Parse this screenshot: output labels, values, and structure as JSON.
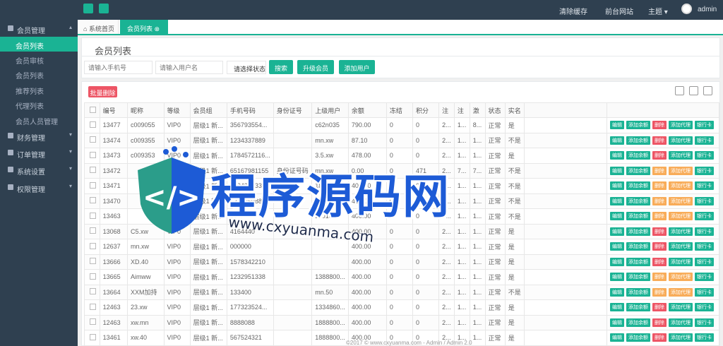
{
  "topbar": {
    "links": [
      "清除缓存",
      "前台网站",
      "主题"
    ],
    "theme_caret": "▾",
    "username": "admin"
  },
  "sidebar": {
    "groups": [
      {
        "label": "会员管理",
        "arrow": "▴"
      },
      {
        "label": "财务管理",
        "arrow": "▾"
      },
      {
        "label": "订单管理",
        "arrow": "▾"
      },
      {
        "label": "系统设置",
        "arrow": "▾"
      },
      {
        "label": "权限管理",
        "arrow": "▾"
      }
    ],
    "items": [
      "会员列表",
      "会员审核",
      "会员列表",
      "推荐列表",
      "代理列表",
      "会员人员管理"
    ]
  },
  "tabs": {
    "home": "系统首页",
    "active": "会员列表",
    "close": "⊗"
  },
  "toolbar": {
    "title": "会员列表",
    "phone_placeholder": "请输入手机号",
    "account_placeholder": "请输入用户名",
    "status_select": "请选择状态",
    "search_label": "搜索",
    "upgrade_label": "升级会员",
    "add_user_label": "添加用户"
  },
  "table_toolbar": {
    "batch_delete_label": "批量删除"
  },
  "table": {
    "headers": [
      "编号",
      "昵称",
      "等级",
      "会员组",
      "手机号码",
      "身份证号",
      "上级用户",
      "余额",
      "冻结",
      "积分",
      "注",
      "注",
      "激",
      "状态",
      "实名",
      ""
    ],
    "rows": [
      [
        "13477",
        "c009055",
        "VIP0",
        "层级1 新...",
        "356793554...",
        "",
        "c62n035",
        "790.00",
        "0",
        "0",
        "2...",
        "1...",
        "8...",
        "正常",
        "是"
      ],
      [
        "13474",
        "c009355",
        "VIP0",
        "层级1 新...",
        "1234337889",
        "",
        "mn.xw",
        "87.10",
        "0",
        "0",
        "2...",
        "1...",
        "1...",
        "正常",
        "不是"
      ],
      [
        "13473",
        "c009353",
        "VIP0",
        "层级1 新...",
        "1784572116...",
        "",
        "3.5.xw",
        "478.00",
        "0",
        "0",
        "2...",
        "1...",
        "1...",
        "正常",
        "是"
      ],
      [
        "13472",
        "",
        "VIP0",
        "层级1 新...",
        "65167981155",
        "身份证号码",
        "mn.xw",
        "0.00",
        "0",
        "471",
        "2...",
        "7...",
        "7...",
        "正常",
        "不是"
      ],
      [
        "13471",
        "",
        "VIP0",
        "层级1 新...",
        "1234328335",
        "",
        "18.mn.xw",
        "400.00",
        "0",
        "0",
        "2...",
        "1...",
        "1...",
        "正常",
        "不是"
      ],
      [
        "13470",
        "",
        "VIP0",
        "层级1 新...",
        "133335988",
        "",
        "J0010.8",
        "400.00",
        "0",
        "0",
        "2...",
        "1...",
        "1...",
        "正常",
        "不是"
      ],
      [
        "13463",
        "",
        "VIP0",
        "层级1 新...",
        "13...",
        "",
        "J0010.8",
        "400.00",
        "0",
        "0",
        "2...",
        "1...",
        "1...",
        "正常",
        "不是"
      ],
      [
        "13068",
        "C5.xw",
        "VIP0",
        "层级1 新...",
        "4164440",
        "",
        "",
        "400.00",
        "0",
        "0",
        "2...",
        "1...",
        "1...",
        "正常",
        "是"
      ],
      [
        "12637",
        "mn.xw",
        "VIP0",
        "层级1 新...",
        "000000",
        "",
        "",
        "400.00",
        "0",
        "0",
        "2...",
        "1...",
        "1...",
        "正常",
        "是"
      ],
      [
        "13666",
        "XD.40",
        "VIP0",
        "层级1 新...",
        "1578342210",
        "",
        "",
        "400.00",
        "0",
        "0",
        "2...",
        "1...",
        "1...",
        "正常",
        "是"
      ],
      [
        "13665",
        "Aimww",
        "VIP0",
        "层级1 新...",
        "1232951338",
        "",
        "1388800...",
        "400.00",
        "0",
        "0",
        "2...",
        "1...",
        "1...",
        "正常",
        "是"
      ],
      [
        "13664",
        "XXM加持",
        "VIP0",
        "层级1 新...",
        "133400",
        "",
        "mn.50",
        "400.00",
        "0",
        "0",
        "2...",
        "1...",
        "1...",
        "正常",
        "不是"
      ],
      [
        "12463",
        "23.xw",
        "VIP0",
        "层级1 新...",
        "177323524...",
        "",
        "1334860...",
        "400.00",
        "0",
        "0",
        "2...",
        "1...",
        "1...",
        "正常",
        "是"
      ],
      [
        "12463",
        "xw.mn",
        "VIP0",
        "层级1 新...",
        "8888088",
        "",
        "1888800...",
        "400.00",
        "0",
        "0",
        "2...",
        "1...",
        "1...",
        "正常",
        "是"
      ],
      [
        "13461",
        "xw.40",
        "VIP0",
        "层级1 新...",
        "567524321",
        "",
        "1888800...",
        "400.00",
        "0",
        "0",
        "2...",
        "1...",
        "1...",
        "正常",
        "是"
      ]
    ],
    "actions": [
      "编辑",
      "添加余额",
      "删除",
      "添加代理",
      "银行卡"
    ],
    "action_variants": [
      "r",
      "r",
      "r",
      "o",
      "o",
      "o",
      "o",
      "r",
      "r",
      "r",
      "o",
      "o",
      "r",
      "r",
      "r"
    ]
  },
  "footer": "©2017 © www.cxyuanma.com - Admin / Admin 2.0",
  "watermark": {
    "cn": "程序源码网",
    "url": "www.cxyuanma.com"
  }
}
